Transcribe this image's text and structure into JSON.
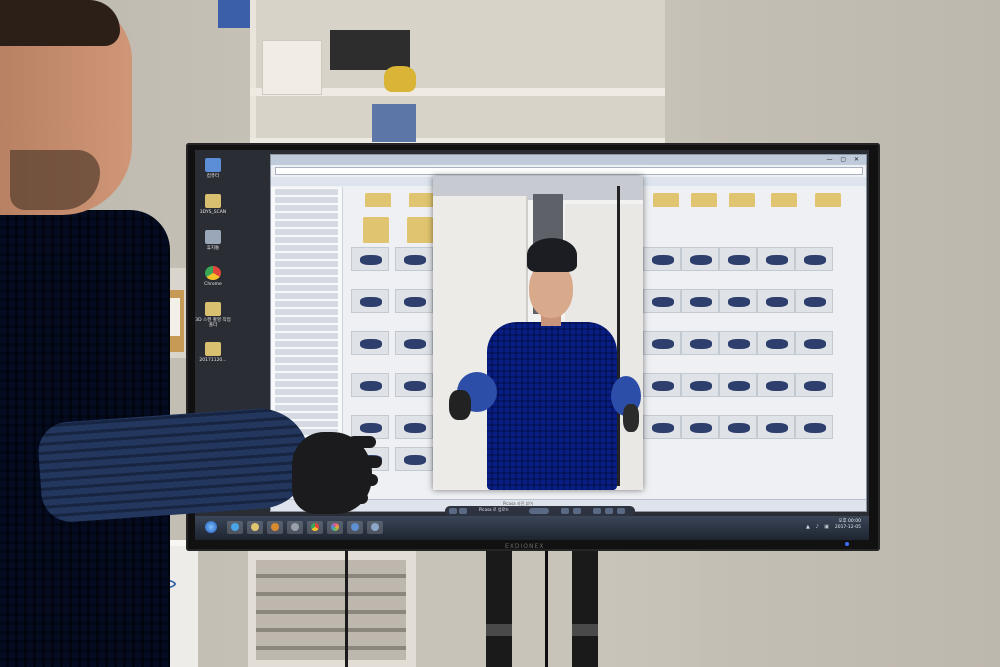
{
  "desktop": {
    "icons": [
      {
        "label": "컴퓨터",
        "color": "#5b8ed6"
      },
      {
        "label": "3DYS_SCAN",
        "color": "#d9c070"
      },
      {
        "label": "휴지통",
        "color": "#9aa7b8"
      },
      {
        "label": "Chrome",
        "color": "#e0473a"
      },
      {
        "label": "3D 스캔 촬영 작업 폴더",
        "color": "#d9c070"
      },
      {
        "label": "20171120...",
        "color": "#d9c070"
      }
    ]
  },
  "viewer": {
    "status": "Picasa 사진 뷰어",
    "controls_label": "Picasa 로 업로드"
  },
  "taskbar": {
    "clock_time": "오후 00:00",
    "clock_date": "2017-12-05",
    "tray": "▲ ♪ ▣"
  },
  "monitor": {
    "brand": "EXDIONEX"
  },
  "colors": {
    "shirt_blue": "#2f57b8",
    "screen_bg": "#2a2d33",
    "taskbar": "#1e2430"
  }
}
